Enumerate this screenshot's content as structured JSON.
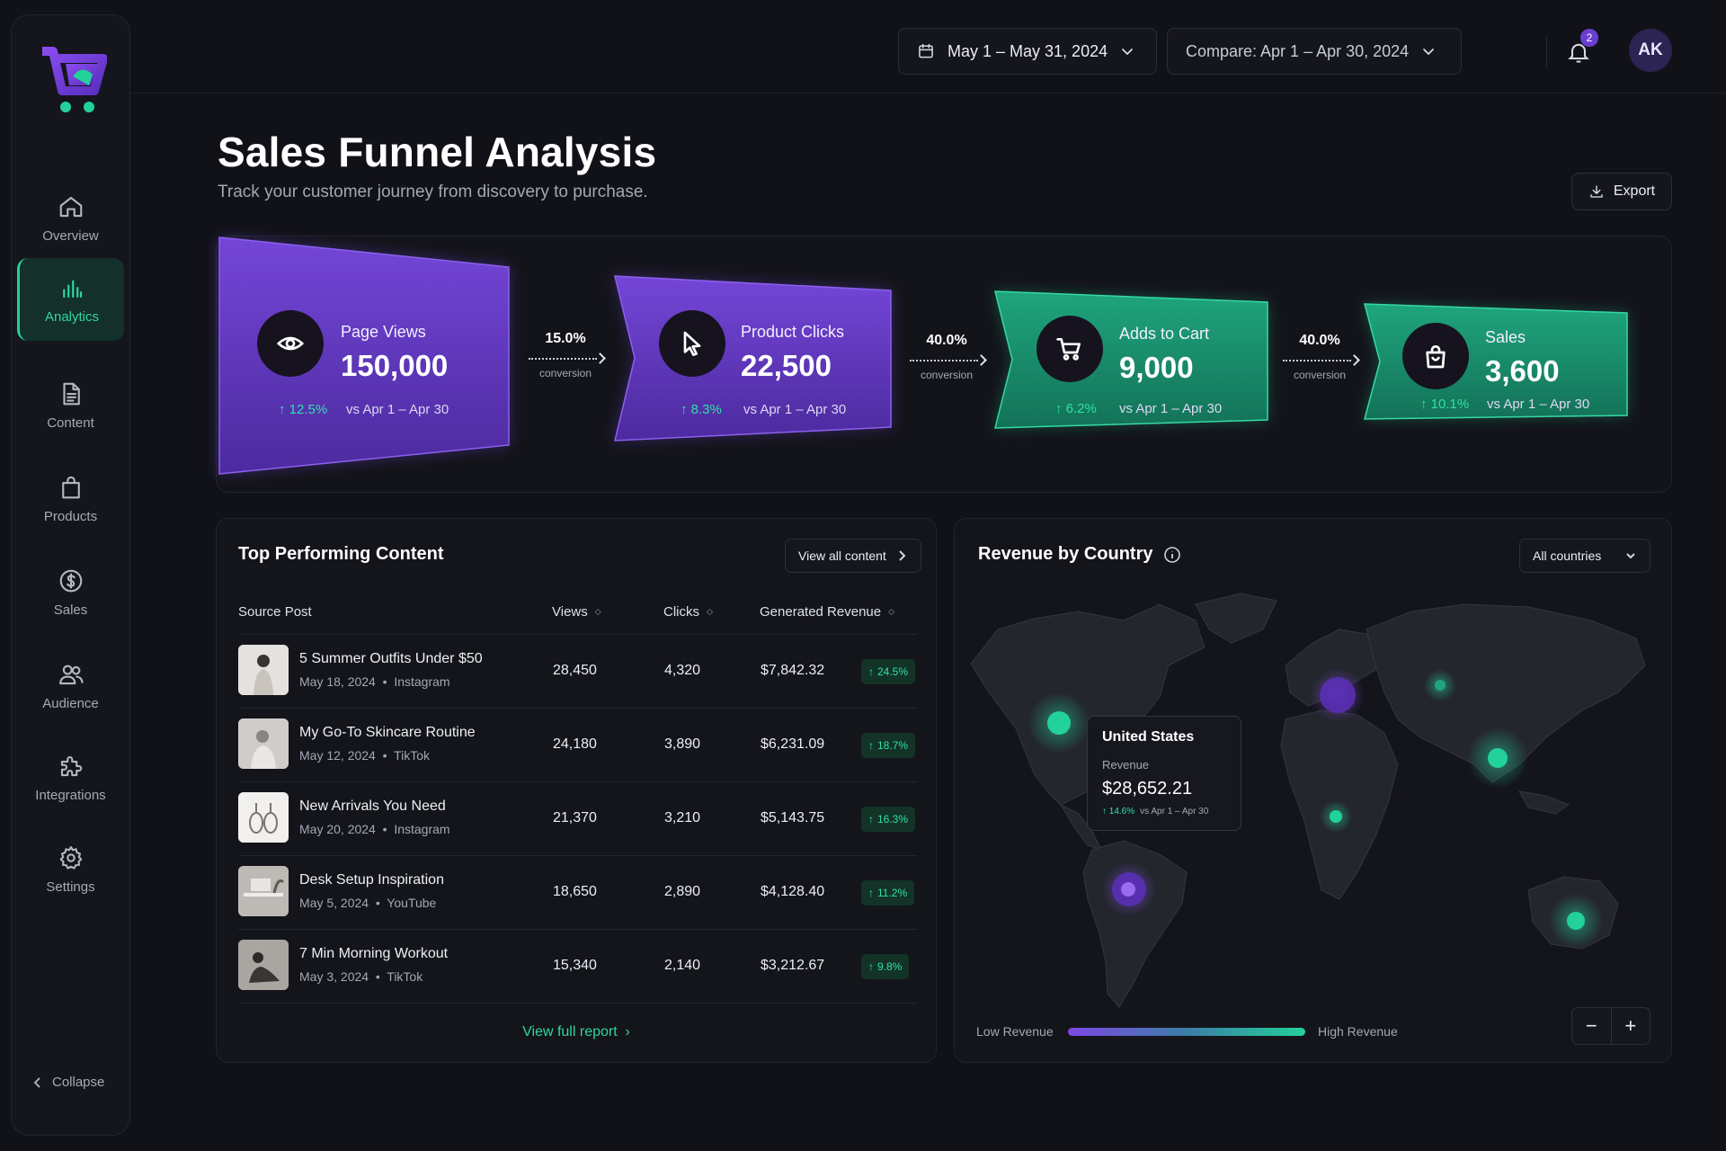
{
  "sidebar": {
    "items": [
      {
        "label": "Overview",
        "icon": "home-icon"
      },
      {
        "label": "Analytics",
        "icon": "analytics-icon"
      },
      {
        "label": "Content",
        "icon": "document-icon"
      },
      {
        "label": "Products",
        "icon": "bag-icon"
      },
      {
        "label": "Sales",
        "icon": "dollar-icon"
      },
      {
        "label": "Audience",
        "icon": "users-icon"
      },
      {
        "label": "Integrations",
        "icon": "puzzle-icon"
      },
      {
        "label": "Settings",
        "icon": "gear-icon"
      }
    ],
    "active": "Analytics",
    "collapse_label": "Collapse"
  },
  "topbar": {
    "date_range": "May 1 – May 31, 2024",
    "compare_range": "Compare: Apr 1 – Apr 30, 2024",
    "notification_count": "2",
    "avatar_initials": "AK"
  },
  "header": {
    "title": "Sales Funnel Analysis",
    "subtitle": "Track your customer journey from discovery to purchase.",
    "export_label": "Export"
  },
  "funnel": {
    "stages": [
      {
        "label": "Page Views",
        "value": "150,000",
        "delta": "12.5%",
        "vs": "vs Apr 1 – Apr 30",
        "icon": "eye-icon"
      },
      {
        "label": "Product Clicks",
        "value": "22,500",
        "delta": "8.3%",
        "vs": "vs Apr 1 – Apr 30",
        "icon": "cursor-icon"
      },
      {
        "label": "Adds to Cart",
        "value": "9,000",
        "delta": "6.2%",
        "vs": "vs Apr 1 – Apr 30",
        "icon": "cart-icon"
      },
      {
        "label": "Sales",
        "value": "3,600",
        "delta": "10.1%",
        "vs": "vs Apr 1 – Apr 30",
        "icon": "shopping-bag-icon"
      }
    ],
    "conversions": [
      {
        "pct": "15.0%",
        "caption": "conversion"
      },
      {
        "pct": "40.0%",
        "caption": "conversion"
      },
      {
        "pct": "40.0%",
        "caption": "conversion"
      }
    ],
    "colors": {
      "purple": "#6a3fd0",
      "green": "#1fa57c"
    }
  },
  "content_table": {
    "title": "Top Performing Content",
    "view_all_label": "View all content",
    "columns": [
      "Source Post",
      "Views",
      "Clicks",
      "Generated Revenue"
    ],
    "rows": [
      {
        "title": "5 Summer Outfits Under $50",
        "date": "May 18, 2024",
        "platform": "Instagram",
        "views": "28,450",
        "clicks": "4,320",
        "revenue": "$7,842.32",
        "change": "24.5%"
      },
      {
        "title": "My Go-To Skincare Routine",
        "date": "May 12, 2024",
        "platform": "TikTok",
        "views": "24,180",
        "clicks": "3,890",
        "revenue": "$6,231.09",
        "change": "18.7%"
      },
      {
        "title": "New Arrivals You Need",
        "date": "May 20, 2024",
        "platform": "Instagram",
        "views": "21,370",
        "clicks": "3,210",
        "revenue": "$5,143.75",
        "change": "16.3%"
      },
      {
        "title": "Desk Setup Inspiration",
        "date": "May 5, 2024",
        "platform": "YouTube",
        "views": "18,650",
        "clicks": "2,890",
        "revenue": "$4,128.40",
        "change": "11.2%"
      },
      {
        "title": "7 Min Morning Workout",
        "date": "May 3, 2024",
        "platform": "TikTok",
        "views": "15,340",
        "clicks": "2,140",
        "revenue": "$3,212.67",
        "change": "9.8%"
      }
    ],
    "footer_link": "View full report"
  },
  "revenue_map": {
    "title": "Revenue by Country",
    "filter": "All countries",
    "tooltip": {
      "country": "United States",
      "label": "Revenue",
      "value": "$28,652.21",
      "change": "14.6%",
      "vs": "vs Apr 1 – Apr 30"
    },
    "legend_low": "Low Revenue",
    "legend_high": "High Revenue",
    "zoom_out": "−",
    "zoom_in": "+"
  }
}
